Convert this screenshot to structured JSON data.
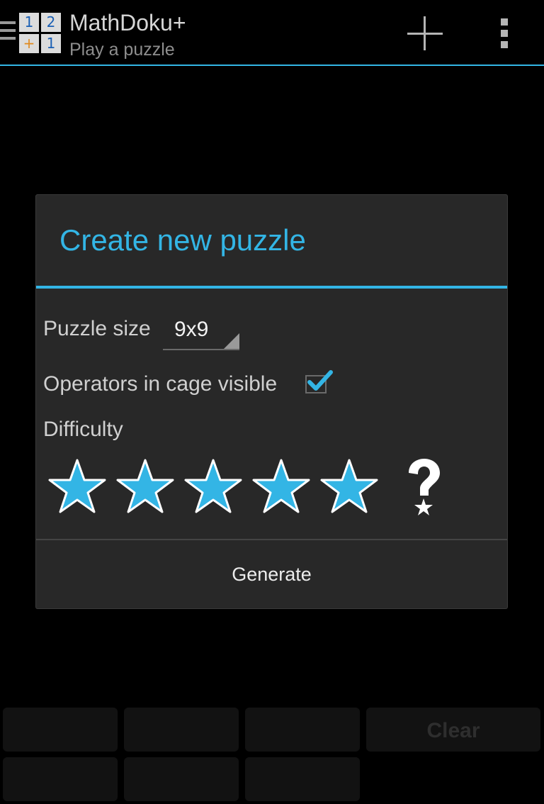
{
  "app": {
    "title": "MathDoku+",
    "subtitle": "Play a puzzle",
    "logo_cells": [
      "1",
      "2",
      "+",
      "1"
    ]
  },
  "toolbar": {
    "add_icon": "plus-icon",
    "overflow_icon": "overflow-menu-icon"
  },
  "dialog": {
    "title": "Create new puzzle",
    "puzzle_size_label": "Puzzle size",
    "puzzle_size_value": "9x9",
    "operators_label": "Operators in cage visible",
    "operators_checked": true,
    "difficulty_label": "Difficulty",
    "difficulty_stars": 5,
    "difficulty_extra_icon": "question-star-icon",
    "generate_label": "Generate"
  },
  "keypad": {
    "clear_label": "Clear"
  },
  "colors": {
    "accent": "#33b5e5",
    "dialog_bg": "#282828",
    "background": "#000000"
  }
}
